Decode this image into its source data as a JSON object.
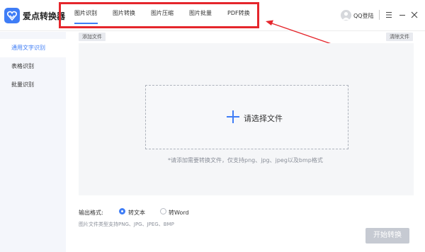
{
  "app": {
    "title": "爱点转换器"
  },
  "header": {
    "tabs": [
      {
        "label": "图片识别",
        "active": true
      },
      {
        "label": "图片转换",
        "active": false
      },
      {
        "label": "图片压缩",
        "active": false
      },
      {
        "label": "图片批量",
        "active": false
      },
      {
        "label": "PDF转换",
        "active": false
      }
    ],
    "login_label": "QQ登陆"
  },
  "sidebar": {
    "items": [
      {
        "label": "通用文字识别",
        "active": true
      },
      {
        "label": "表格识别",
        "active": false
      },
      {
        "label": "批量识别",
        "active": false
      }
    ]
  },
  "main": {
    "add_file": "添加文件",
    "clear_file": "清除文件",
    "drop_text": "请选择文件",
    "hint": "*请添加需要转换文件，仅支持png、jpg、jpeg以及bmp格式",
    "format_label": "输出格式:",
    "options": [
      {
        "label": "转文本",
        "checked": true
      },
      {
        "label": "转Word",
        "checked": false
      }
    ],
    "support_text": "图片文件类型支持PNG、JPG、JPEG、BMP",
    "start_button": "开始转换"
  },
  "colors": {
    "accent": "#3f7df6",
    "annotation": "#e5262c",
    "sidebar_bg": "#f4f6fb",
    "disabled_button": "#c6cad2"
  },
  "icons": [
    "app-logo-icon",
    "user-avatar-icon",
    "menu-icon",
    "minimize-icon",
    "close-icon",
    "plus-icon"
  ]
}
